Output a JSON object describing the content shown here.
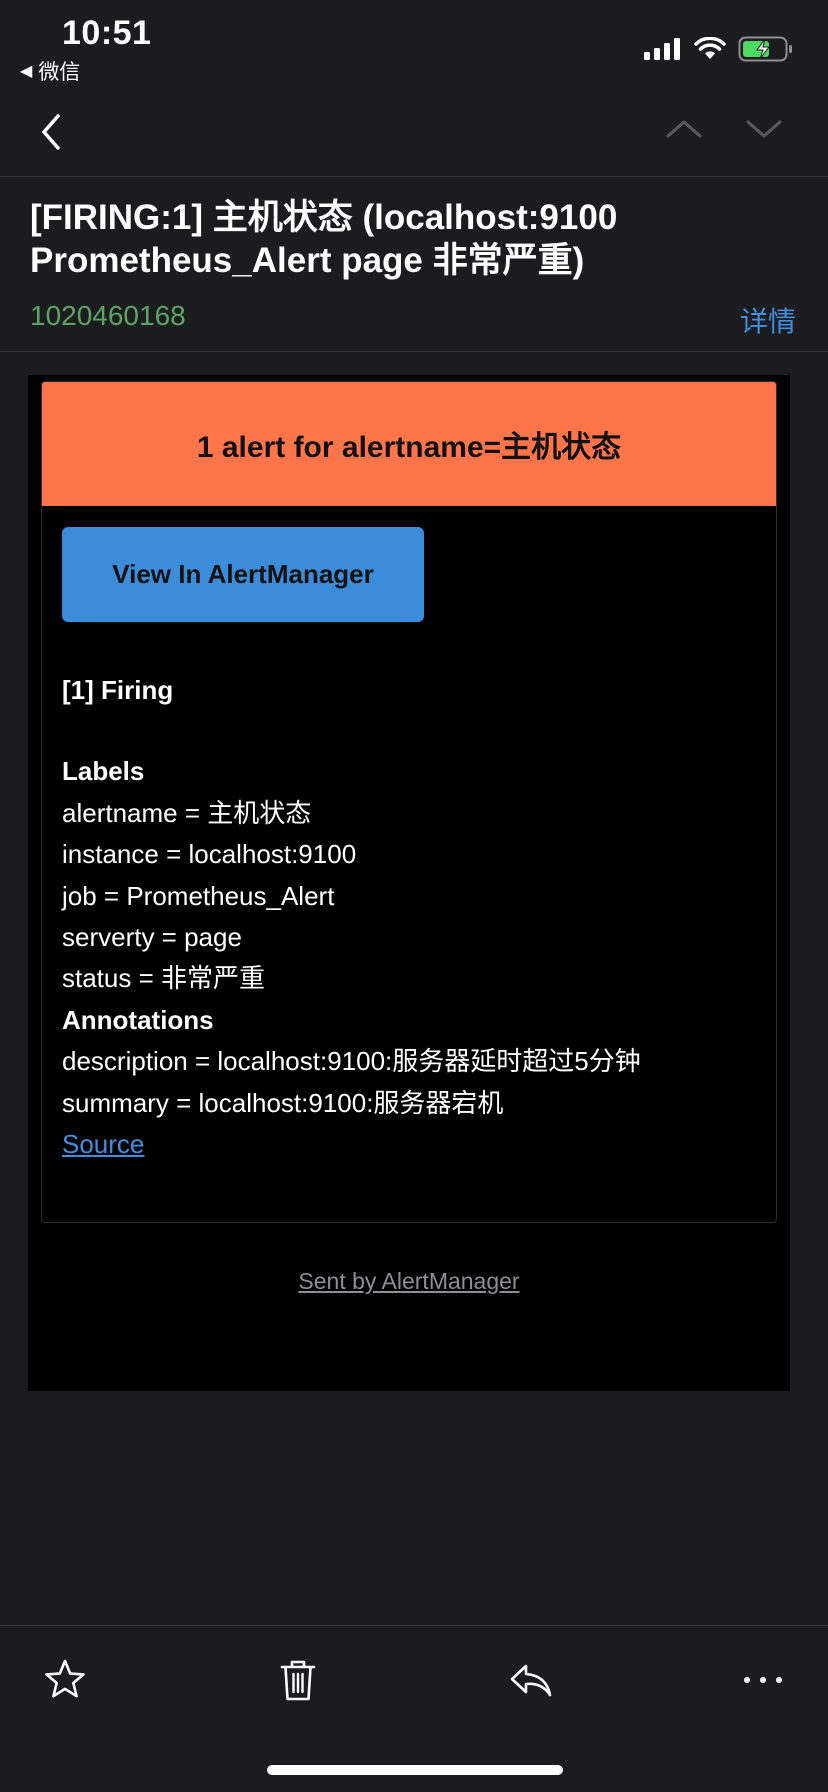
{
  "status_bar": {
    "time": "10:51",
    "back_app": "微信",
    "icons": [
      "signal-icon",
      "wifi-icon",
      "battery-charging-icon"
    ]
  },
  "nav": {
    "icons": [
      "chevron-left-icon",
      "chevron-up-icon",
      "chevron-down-icon"
    ]
  },
  "header": {
    "subject_line1": "[FIRING:1] 主机状态 (localhost:9100",
    "subject_line2": "Prometheus_Alert page 非常严重)",
    "sender": "1020460168",
    "details_label": "详情"
  },
  "email": {
    "alert_title": "1 alert for alertname=主机状态",
    "view_button": "View In AlertManager",
    "firing": "[1] Firing",
    "labels_heading": "Labels",
    "labels": [
      "alertname = 主机状态",
      "instance = localhost:9100",
      "job = Prometheus_Alert",
      "serverty = page",
      "status = 非常严重"
    ],
    "annotations_heading": "Annotations",
    "annotations": [
      "description = localhost:9100:服务器延时超过5分钟",
      "summary = localhost:9100:服务器宕机"
    ],
    "source_link": "Source",
    "footer": "Sent by AlertManager"
  },
  "toolbar": {
    "icons": [
      "star-icon",
      "trash-icon",
      "reply-icon",
      "more-icon"
    ]
  },
  "colors": {
    "background": "#1c1c1e",
    "alert_header": "#ff7549",
    "button": "#3b8ddc",
    "link": "#3f8ee0",
    "sender": "#5aa564"
  }
}
